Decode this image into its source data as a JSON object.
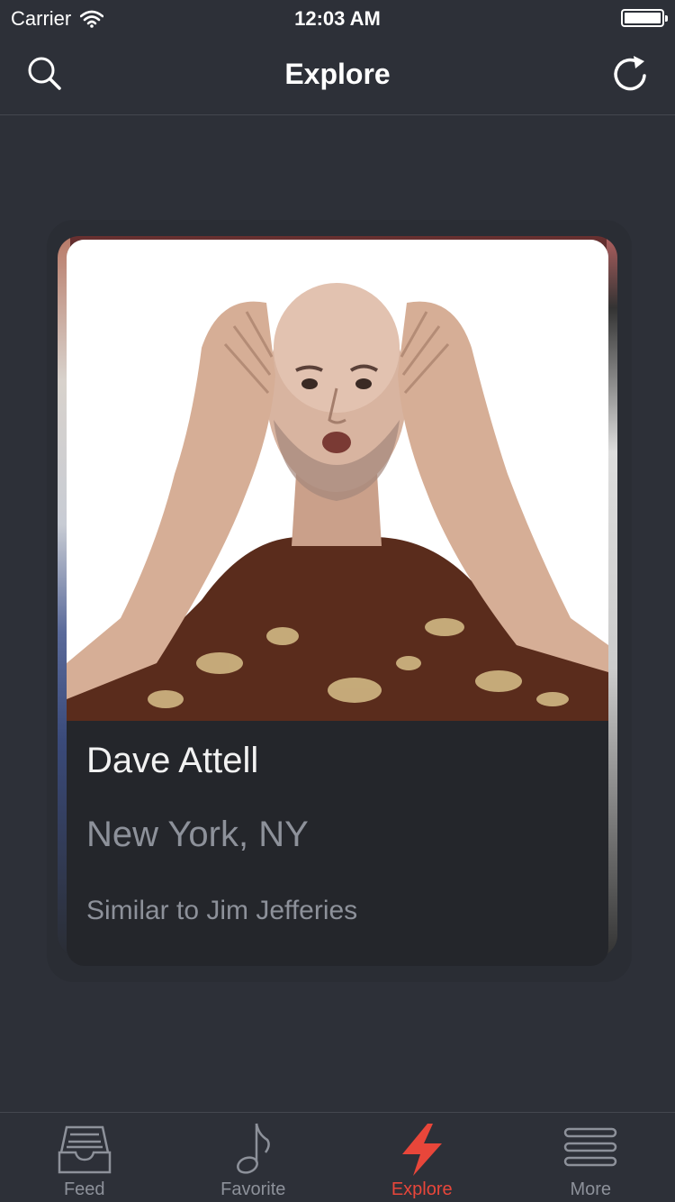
{
  "status_bar": {
    "carrier": "Carrier",
    "time": "12:03 AM"
  },
  "nav": {
    "title": "Explore",
    "left_icon": "search-icon",
    "right_icon": "refresh-icon"
  },
  "card": {
    "name": "Dave Attell",
    "location": "New York, NY",
    "similar": "Similar to Jim Jefferies"
  },
  "tabs": [
    {
      "label": "Feed",
      "icon": "inbox-icon",
      "active": false
    },
    {
      "label": "Favorite",
      "icon": "music-note-icon",
      "active": false
    },
    {
      "label": "Explore",
      "icon": "lightning-icon",
      "active": true
    },
    {
      "label": "More",
      "icon": "menu-icon",
      "active": false
    }
  ],
  "colors": {
    "background": "#2d3038",
    "accent": "#e8463a",
    "muted_text": "#8d919a",
    "card": "#24262b"
  }
}
